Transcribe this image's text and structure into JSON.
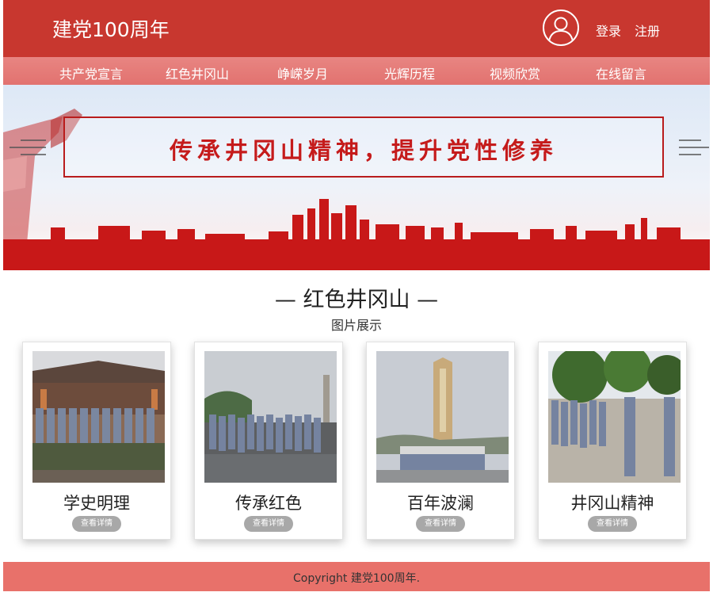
{
  "header": {
    "site_title": "建党100周年",
    "login_label": "登录",
    "register_label": "注册",
    "brand_color": "#c8372f"
  },
  "nav": {
    "items": [
      {
        "label": "共产党宣言"
      },
      {
        "label": "红色井冈山"
      },
      {
        "label": "峥嵘岁月"
      },
      {
        "label": "光辉历程"
      },
      {
        "label": "视频欣赏"
      },
      {
        "label": "在线留言"
      }
    ]
  },
  "banner": {
    "slogan": "传承井冈山精神，提升党性修养",
    "prev_icon": "menu-lines-icon",
    "next_icon": "menu-lines-icon"
  },
  "section": {
    "title": "— 红色井冈山 —",
    "subtitle": "图片展示"
  },
  "cards": [
    {
      "title": "学史明理",
      "button_label": "查看详情",
      "photo_icon": "group-photo-courtyard"
    },
    {
      "title": "传承红色",
      "button_label": "查看详情",
      "photo_icon": "group-photo-rain"
    },
    {
      "title": "百年波澜",
      "button_label": "查看详情",
      "photo_icon": "monument-photo"
    },
    {
      "title": "井冈山精神",
      "button_label": "查看详情",
      "photo_icon": "group-photo-trees"
    }
  ],
  "footer": {
    "copyright": "Copyright 建党100周年."
  }
}
